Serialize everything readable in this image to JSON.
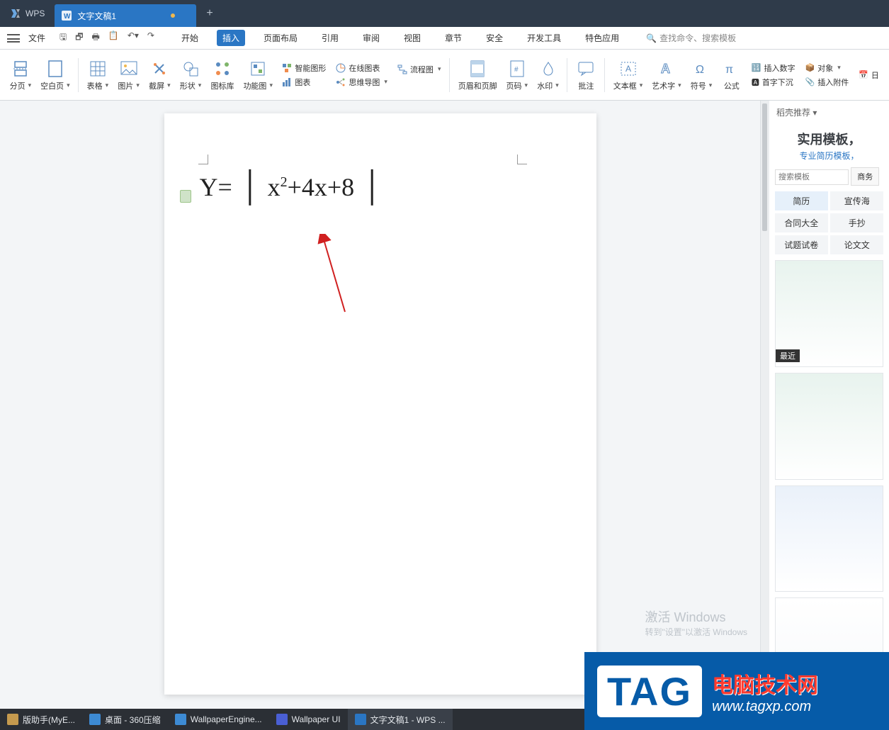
{
  "titlebar": {
    "app_name": "WPS",
    "doc_tab": "文字文稿1",
    "new_tab_tooltip": "+"
  },
  "menubar": {
    "file": "文件",
    "tabs": [
      "开始",
      "插入",
      "页面布局",
      "引用",
      "审阅",
      "视图",
      "章节",
      "安全",
      "开发工具",
      "特色应用"
    ],
    "active_tab": "插入",
    "search_placeholder": "查找命令、搜索模板"
  },
  "ribbon": {
    "page_break": "分页",
    "blank_page": "空白页",
    "table": "表格",
    "picture": "图片",
    "screenshot": "截屏",
    "shapes": "形状",
    "icon_lib": "图标库",
    "func_diagram": "功能图",
    "smart_graphic": "智能图形",
    "online_chart": "在线图表",
    "flowchart": "流程图",
    "chart": "图表",
    "mindmap": "思维导图",
    "header_footer": "页眉和页脚",
    "page_number": "页码",
    "watermark": "水印",
    "comment": "批注",
    "textbox": "文本框",
    "wordart": "艺术字",
    "symbol": "符号",
    "equation": "公式",
    "insert_number": "插入数字",
    "drop_cap": "首字下沉",
    "object": "对象",
    "attachment": "插入附件",
    "date": "日"
  },
  "document": {
    "formula_prefix": "Y=",
    "formula_body": "x²+4x+8"
  },
  "rightpanel": {
    "header": "稻壳推荐",
    "title": "实用模板，",
    "subtitle": "专业简历模板，",
    "search_placeholder": "搜索模板",
    "search_btn": "商务",
    "categories": [
      "简历",
      "宣传海",
      "合同大全",
      "手抄",
      "试题试卷",
      "论文文"
    ],
    "active_category": "简历",
    "badge_recent": "最近"
  },
  "watermark": {
    "line1": "激活 Windows",
    "line2": "转到\"设置\"以激活 Windows"
  },
  "taskbar": {
    "items": [
      "版助手(MyE...",
      "桌面 - 360压缩",
      "WallpaperEngine...",
      "Wallpaper UI",
      "文字文稿1 - WPS ..."
    ],
    "active_index": 4
  },
  "overlay": {
    "tag": "TAG",
    "cn": "电脑技术网",
    "url": "www.tagxp.com"
  }
}
